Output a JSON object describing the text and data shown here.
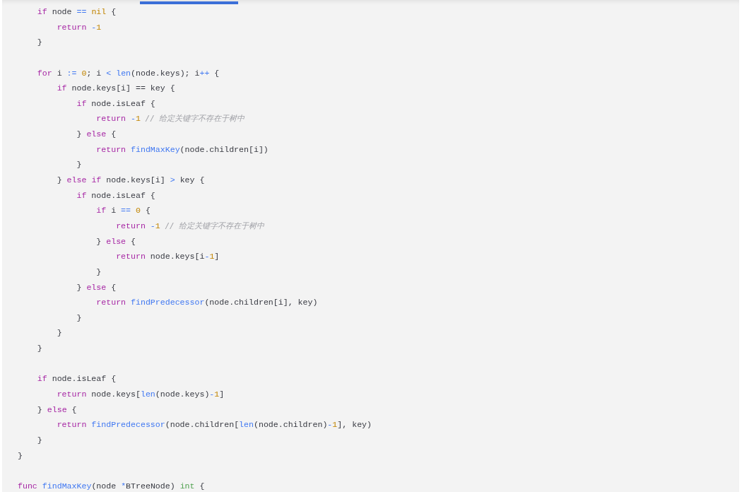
{
  "code_block": {
    "lines": [
      {
        "kind": "code",
        "tokens": [
          {
            "kind": "keyword",
            "text": "    if"
          },
          {
            "kind": "plain",
            "text": " node "
          },
          {
            "kind": "operator",
            "text": "=="
          },
          {
            "kind": "number",
            "text": " nil"
          },
          {
            "kind": "plain",
            "text": " {"
          }
        ]
      },
      {
        "kind": "code",
        "tokens": [
          {
            "kind": "keyword",
            "text": "        return"
          },
          {
            "kind": "operator",
            "text": " -"
          },
          {
            "kind": "number",
            "text": "1"
          }
        ]
      },
      {
        "kind": "code",
        "tokens": [
          {
            "kind": "plain",
            "text": "    }"
          }
        ]
      },
      {
        "kind": "blank"
      },
      {
        "kind": "code",
        "tokens": [
          {
            "kind": "keyword",
            "text": "    for"
          },
          {
            "kind": "plain",
            "text": " i "
          },
          {
            "kind": "operator",
            "text": ":="
          },
          {
            "kind": "number",
            "text": " 0"
          },
          {
            "kind": "plain",
            "text": "; i "
          },
          {
            "kind": "operator",
            "text": "<"
          },
          {
            "kind": "function",
            "text": " len"
          },
          {
            "kind": "plain",
            "text": "(node.keys); i"
          },
          {
            "kind": "operator",
            "text": "++"
          },
          {
            "kind": "plain",
            "text": " {"
          }
        ]
      },
      {
        "kind": "code",
        "tokens": [
          {
            "kind": "keyword",
            "text": "        if"
          },
          {
            "kind": "plain",
            "text": " node.keys[i] == key {"
          }
        ]
      },
      {
        "kind": "code",
        "tokens": [
          {
            "kind": "keyword",
            "text": "            if"
          },
          {
            "kind": "plain",
            "text": " node.isLeaf {"
          }
        ]
      },
      {
        "kind": "code",
        "tokens": [
          {
            "kind": "keyword",
            "text": "                return"
          },
          {
            "kind": "operator",
            "text": " -"
          },
          {
            "kind": "number",
            "text": "1"
          },
          {
            "kind": "comment",
            "text": " // 给定关键字不存在于树中"
          }
        ]
      },
      {
        "kind": "code",
        "tokens": [
          {
            "kind": "plain",
            "text": "            }"
          },
          {
            "kind": "keyword",
            "text": " else"
          },
          {
            "kind": "plain",
            "text": " {"
          }
        ]
      },
      {
        "kind": "code",
        "tokens": [
          {
            "kind": "keyword",
            "text": "                return"
          },
          {
            "kind": "function",
            "text": " findMaxKey"
          },
          {
            "kind": "plain",
            "text": "(node.children[i])"
          }
        ]
      },
      {
        "kind": "code",
        "tokens": [
          {
            "kind": "plain",
            "text": "            }"
          }
        ]
      },
      {
        "kind": "code",
        "tokens": [
          {
            "kind": "plain",
            "text": "        }"
          },
          {
            "kind": "keyword",
            "text": " else"
          },
          {
            "kind": "keyword",
            "text": " if"
          },
          {
            "kind": "plain",
            "text": " node.keys[i] "
          },
          {
            "kind": "operator",
            "text": ">"
          },
          {
            "kind": "plain",
            "text": " key {"
          }
        ]
      },
      {
        "kind": "code",
        "tokens": [
          {
            "kind": "keyword",
            "text": "            if"
          },
          {
            "kind": "plain",
            "text": " node.isLeaf {"
          }
        ]
      },
      {
        "kind": "code",
        "tokens": [
          {
            "kind": "keyword",
            "text": "                if"
          },
          {
            "kind": "plain",
            "text": " i "
          },
          {
            "kind": "operator",
            "text": "=="
          },
          {
            "kind": "number",
            "text": " 0"
          },
          {
            "kind": "plain",
            "text": " {"
          }
        ]
      },
      {
        "kind": "code",
        "tokens": [
          {
            "kind": "keyword",
            "text": "                    return"
          },
          {
            "kind": "operator",
            "text": " -"
          },
          {
            "kind": "number",
            "text": "1"
          },
          {
            "kind": "comment",
            "text": " // 给定关键字不存在于树中"
          }
        ]
      },
      {
        "kind": "code",
        "tokens": [
          {
            "kind": "plain",
            "text": "                }"
          },
          {
            "kind": "keyword",
            "text": " else"
          },
          {
            "kind": "plain",
            "text": " {"
          }
        ]
      },
      {
        "kind": "code",
        "tokens": [
          {
            "kind": "keyword",
            "text": "                    return"
          },
          {
            "kind": "plain",
            "text": " node.keys[i"
          },
          {
            "kind": "operator",
            "text": "-"
          },
          {
            "kind": "number",
            "text": "1"
          },
          {
            "kind": "plain",
            "text": "]"
          }
        ]
      },
      {
        "kind": "code",
        "tokens": [
          {
            "kind": "plain",
            "text": "                }"
          }
        ]
      },
      {
        "kind": "code",
        "tokens": [
          {
            "kind": "plain",
            "text": "            }"
          },
          {
            "kind": "keyword",
            "text": " else"
          },
          {
            "kind": "plain",
            "text": " {"
          }
        ]
      },
      {
        "kind": "code",
        "tokens": [
          {
            "kind": "keyword",
            "text": "                return"
          },
          {
            "kind": "function",
            "text": " findPredecessor"
          },
          {
            "kind": "plain",
            "text": "(node.children[i], key)"
          }
        ]
      },
      {
        "kind": "code",
        "tokens": [
          {
            "kind": "plain",
            "text": "            }"
          }
        ]
      },
      {
        "kind": "code",
        "tokens": [
          {
            "kind": "plain",
            "text": "        }"
          }
        ]
      },
      {
        "kind": "code",
        "tokens": [
          {
            "kind": "plain",
            "text": "    }"
          }
        ]
      },
      {
        "kind": "blank"
      },
      {
        "kind": "code",
        "tokens": [
          {
            "kind": "keyword",
            "text": "    if"
          },
          {
            "kind": "plain",
            "text": " node.isLeaf {"
          }
        ]
      },
      {
        "kind": "code",
        "tokens": [
          {
            "kind": "keyword",
            "text": "        return"
          },
          {
            "kind": "plain",
            "text": " node.keys["
          },
          {
            "kind": "function",
            "text": "len"
          },
          {
            "kind": "plain",
            "text": "(node.keys)"
          },
          {
            "kind": "operator",
            "text": "-"
          },
          {
            "kind": "number",
            "text": "1"
          },
          {
            "kind": "plain",
            "text": "]"
          }
        ]
      },
      {
        "kind": "code",
        "tokens": [
          {
            "kind": "plain",
            "text": "    }"
          },
          {
            "kind": "keyword",
            "text": " else"
          },
          {
            "kind": "plain",
            "text": " {"
          }
        ]
      },
      {
        "kind": "code",
        "tokens": [
          {
            "kind": "keyword",
            "text": "        return"
          },
          {
            "kind": "function",
            "text": " findPredecessor"
          },
          {
            "kind": "plain",
            "text": "(node.children["
          },
          {
            "kind": "function",
            "text": "len"
          },
          {
            "kind": "plain",
            "text": "(node.children)"
          },
          {
            "kind": "operator",
            "text": "-"
          },
          {
            "kind": "number",
            "text": "1"
          },
          {
            "kind": "plain",
            "text": "], key)"
          }
        ]
      },
      {
        "kind": "code",
        "tokens": [
          {
            "kind": "plain",
            "text": "    }"
          }
        ]
      },
      {
        "kind": "code",
        "tokens": [
          {
            "kind": "plain",
            "text": "}"
          }
        ]
      },
      {
        "kind": "blank"
      },
      {
        "kind": "code",
        "tokens": [
          {
            "kind": "keyword",
            "text": "func"
          },
          {
            "kind": "function",
            "text": " findMaxKey"
          },
          {
            "kind": "plain",
            "text": "(node "
          },
          {
            "kind": "operator",
            "text": "*"
          },
          {
            "kind": "plain",
            "text": "BTreeNode) "
          },
          {
            "kind": "type",
            "text": "int"
          },
          {
            "kind": "plain",
            "text": " {"
          }
        ]
      }
    ]
  }
}
